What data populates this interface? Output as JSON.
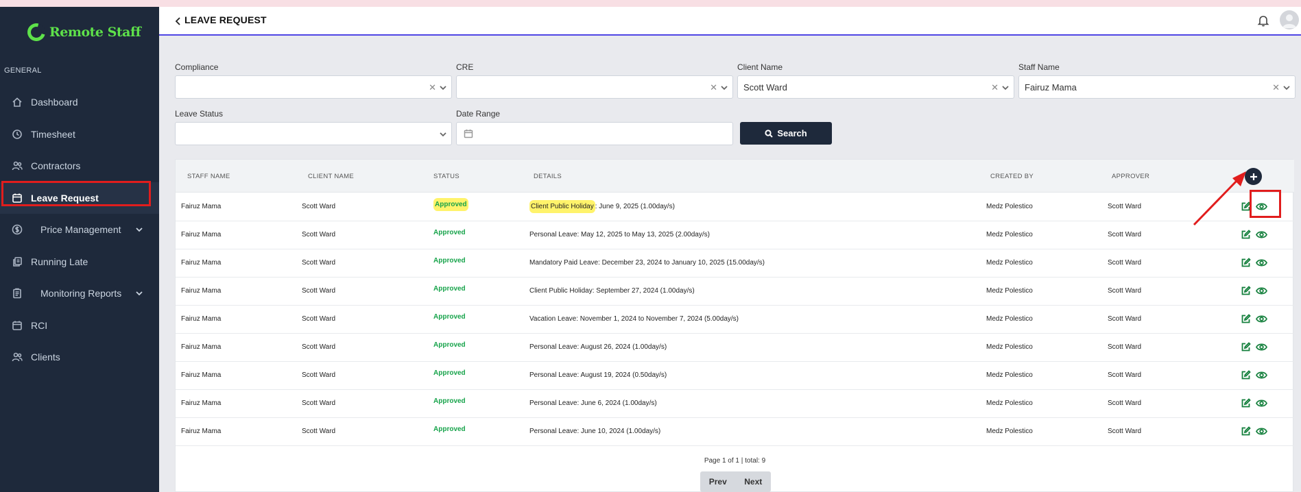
{
  "app": {
    "brand": "Remote Staff",
    "brand_color": "#5ee14a"
  },
  "sidebar": {
    "section": "GENERAL",
    "items": [
      {
        "label": "Dashboard",
        "icon": "home-icon"
      },
      {
        "label": "Timesheet",
        "icon": "clock-icon"
      },
      {
        "label": "Contractors",
        "icon": "users-icon"
      },
      {
        "label": "Leave Request",
        "icon": "calendar-icon",
        "active": true
      },
      {
        "label": "Price Management",
        "icon": "dollar-icon",
        "expandable": true
      },
      {
        "label": "Running Late",
        "icon": "copy-icon"
      },
      {
        "label": "Monitoring Reports",
        "icon": "clipboard-icon",
        "expandable": true
      },
      {
        "label": "RCI",
        "icon": "calendar-icon"
      },
      {
        "label": "Clients",
        "icon": "users-icon"
      }
    ]
  },
  "header": {
    "title": "LEAVE REQUEST"
  },
  "filters": {
    "compliance": {
      "label": "Compliance",
      "value": ""
    },
    "cre": {
      "label": "CRE",
      "value": ""
    },
    "client_name": {
      "label": "Client Name",
      "value": "Scott Ward"
    },
    "staff_name": {
      "label": "Staff Name",
      "value": "Fairuz Mama"
    },
    "leave_status": {
      "label": "Leave Status",
      "value": ""
    },
    "date_range": {
      "label": "Date Range",
      "value": ""
    },
    "search_label": "Search"
  },
  "table": {
    "columns": [
      "STAFF NAME",
      "CLIENT NAME",
      "STATUS",
      "DETAILS",
      "CREATED BY",
      "APPROVER"
    ],
    "rows": [
      {
        "staff": "Fairuz Mama",
        "client": "Scott Ward",
        "status": "Approved",
        "type": "Client Public Holiday",
        "details": ": June 9, 2025 (1.00day/s)",
        "created_by": "Medz Polestico",
        "approver": "Scott Ward"
      },
      {
        "staff": "Fairuz Mama",
        "client": "Scott Ward",
        "status": "Approved",
        "type": "Personal Leave",
        "details": ": May 12, 2025 to May 13, 2025 (2.00day/s)",
        "created_by": "Medz Polestico",
        "approver": "Scott Ward"
      },
      {
        "staff": "Fairuz Mama",
        "client": "Scott Ward",
        "status": "Approved",
        "type": "Mandatory Paid Leave",
        "details": ": December 23, 2024 to January 10, 2025 (15.00day/s)",
        "created_by": "Medz Polestico",
        "approver": "Scott Ward"
      },
      {
        "staff": "Fairuz Mama",
        "client": "Scott Ward",
        "status": "Approved",
        "type": "Client Public Holiday",
        "details": ": September 27, 2024 (1.00day/s)",
        "created_by": "Medz Polestico",
        "approver": "Scott Ward"
      },
      {
        "staff": "Fairuz Mama",
        "client": "Scott Ward",
        "status": "Approved",
        "type": "Vacation Leave",
        "details": ": November 1, 2024 to November 7, 2024 (5.00day/s)",
        "created_by": "Medz Polestico",
        "approver": "Scott Ward"
      },
      {
        "staff": "Fairuz Mama",
        "client": "Scott Ward",
        "status": "Approved",
        "type": "Personal Leave",
        "details": ": August 26, 2024 (1.00day/s)",
        "created_by": "Medz Polestico",
        "approver": "Scott Ward"
      },
      {
        "staff": "Fairuz Mama",
        "client": "Scott Ward",
        "status": "Approved",
        "type": "Personal Leave",
        "details": ": August 19, 2024 (0.50day/s)",
        "created_by": "Medz Polestico",
        "approver": "Scott Ward"
      },
      {
        "staff": "Fairuz Mama",
        "client": "Scott Ward",
        "status": "Approved",
        "type": "Personal Leave",
        "details": ": June 6, 2024 (1.00day/s)",
        "created_by": "Medz Polestico",
        "approver": "Scott Ward"
      },
      {
        "staff": "Fairuz Mama",
        "client": "Scott Ward",
        "status": "Approved",
        "type": "Personal Leave",
        "details": ": June 10, 2024 (1.00day/s)",
        "created_by": "Medz Polestico",
        "approver": "Scott Ward"
      }
    ]
  },
  "pagination": {
    "info": "Page 1 of 1 | total: 9",
    "prev": "Prev",
    "next": "Next"
  },
  "colors": {
    "status_approved": "#16a34a",
    "sidebar_bg": "#1e293b",
    "annotation": "#e11d1d",
    "highlight": "#fff36b"
  }
}
